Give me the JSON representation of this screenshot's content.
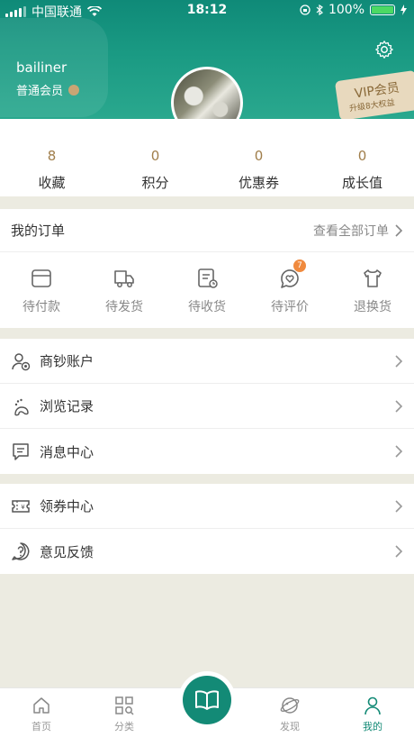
{
  "status_bar": {
    "carrier": "中国联通",
    "time": "18:12",
    "battery": "100%"
  },
  "profile": {
    "username": "bailiner",
    "member_level": "普通会员"
  },
  "vip": {
    "title": "VIP会员",
    "subtitle": "升级8大权益"
  },
  "stats": [
    {
      "value": "8",
      "label": "收藏"
    },
    {
      "value": "0",
      "label": "积分"
    },
    {
      "value": "0",
      "label": "优惠券"
    },
    {
      "value": "0",
      "label": "成长值"
    }
  ],
  "orders": {
    "title": "我的订单",
    "view_all": "查看全部订单",
    "items": [
      {
        "label": "待付款",
        "icon": "wallet-icon"
      },
      {
        "label": "待发货",
        "icon": "truck-icon"
      },
      {
        "label": "待收货",
        "icon": "package-clock-icon"
      },
      {
        "label": "待评价",
        "icon": "heart-chat-icon",
        "badge": "7"
      },
      {
        "label": "退换货",
        "icon": "shirt-icon"
      }
    ]
  },
  "menu_group_1": [
    {
      "label": "商钞账户",
      "icon": "user-coin-icon"
    },
    {
      "label": "浏览记录",
      "icon": "footprint-icon"
    },
    {
      "label": "消息中心",
      "icon": "message-icon"
    }
  ],
  "menu_group_2": [
    {
      "label": "领券中心",
      "icon": "coupon-icon"
    },
    {
      "label": "意见反馈",
      "icon": "question-icon"
    }
  ],
  "tabbar": {
    "items": [
      {
        "label": "首页",
        "icon": "home-icon"
      },
      {
        "label": "分类",
        "icon": "grid-search-icon"
      },
      {
        "label": "",
        "icon": "book-icon"
      },
      {
        "label": "发现",
        "icon": "planet-icon"
      },
      {
        "label": "我的",
        "icon": "user-icon",
        "active": true
      }
    ]
  },
  "colors": {
    "primary": "#138a76",
    "accent_gold": "#a07e4b",
    "badge": "#f08a3e",
    "background": "#ecebe1"
  }
}
